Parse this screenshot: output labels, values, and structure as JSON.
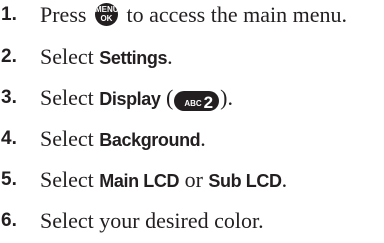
{
  "steps": [
    {
      "num": "1.",
      "pre": "Press",
      "key": {
        "icon": "menu-ok-key-icon",
        "line1": "MENU",
        "line2": "OK"
      },
      "post": "to access the main menu."
    },
    {
      "num": "2.",
      "pre": "Select ",
      "keyword": "Settings",
      "post": "."
    },
    {
      "num": "3.",
      "pre": "Select ",
      "keyword": "Display",
      "paren_open": " (",
      "key": {
        "icon": "abc2-key-icon",
        "small": "ABC",
        "big": "2"
      },
      "paren_close": ")."
    },
    {
      "num": "4.",
      "pre": "Select ",
      "keyword": "Background",
      "post": "."
    },
    {
      "num": "5.",
      "pre": "Select ",
      "keyword": "Main LCD",
      "mid": " or ",
      "keyword2": "Sub LCD",
      "post": "."
    },
    {
      "num": "6.",
      "pre": "Select your desired color."
    }
  ]
}
